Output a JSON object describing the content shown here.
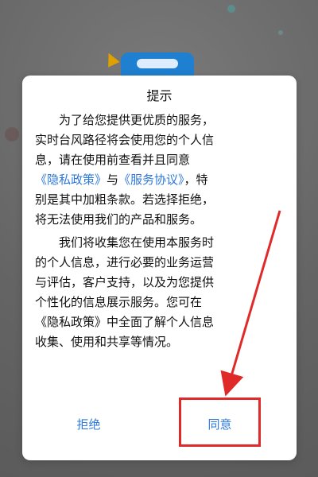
{
  "dialog": {
    "title": "提示",
    "paragraph1": {
      "line1": "为了给您提供更优质的服务，",
      "line2": "实时台风路径将会使用您的个人信",
      "line3": "息，请在使用前查看并且同意",
      "link_privacy": "《隐私政策》",
      "and_text": "与",
      "link_service": "《服务协议》",
      "after_links": "，特",
      "line5": "别是其中加粗条款。若选择拒绝，",
      "line6": "将无法使用我们的产品和服务。"
    },
    "paragraph2": {
      "line1": "我们将收集您在使用本服务时",
      "line2": "的个人信息，进行必要的业务运营",
      "line3": "与评估，客户支持，以及为您提供",
      "line4": "个性化的信息展示服务。您可在",
      "line5": "《隐私政策》中全面了解个人信息",
      "line6": "收集、使用和共享等情况。"
    },
    "reject_label": "拒绝",
    "agree_label": "同意"
  },
  "colors": {
    "link": "#2d78d9",
    "annotation": "#e02a2a",
    "background": "#6f6f6f"
  }
}
